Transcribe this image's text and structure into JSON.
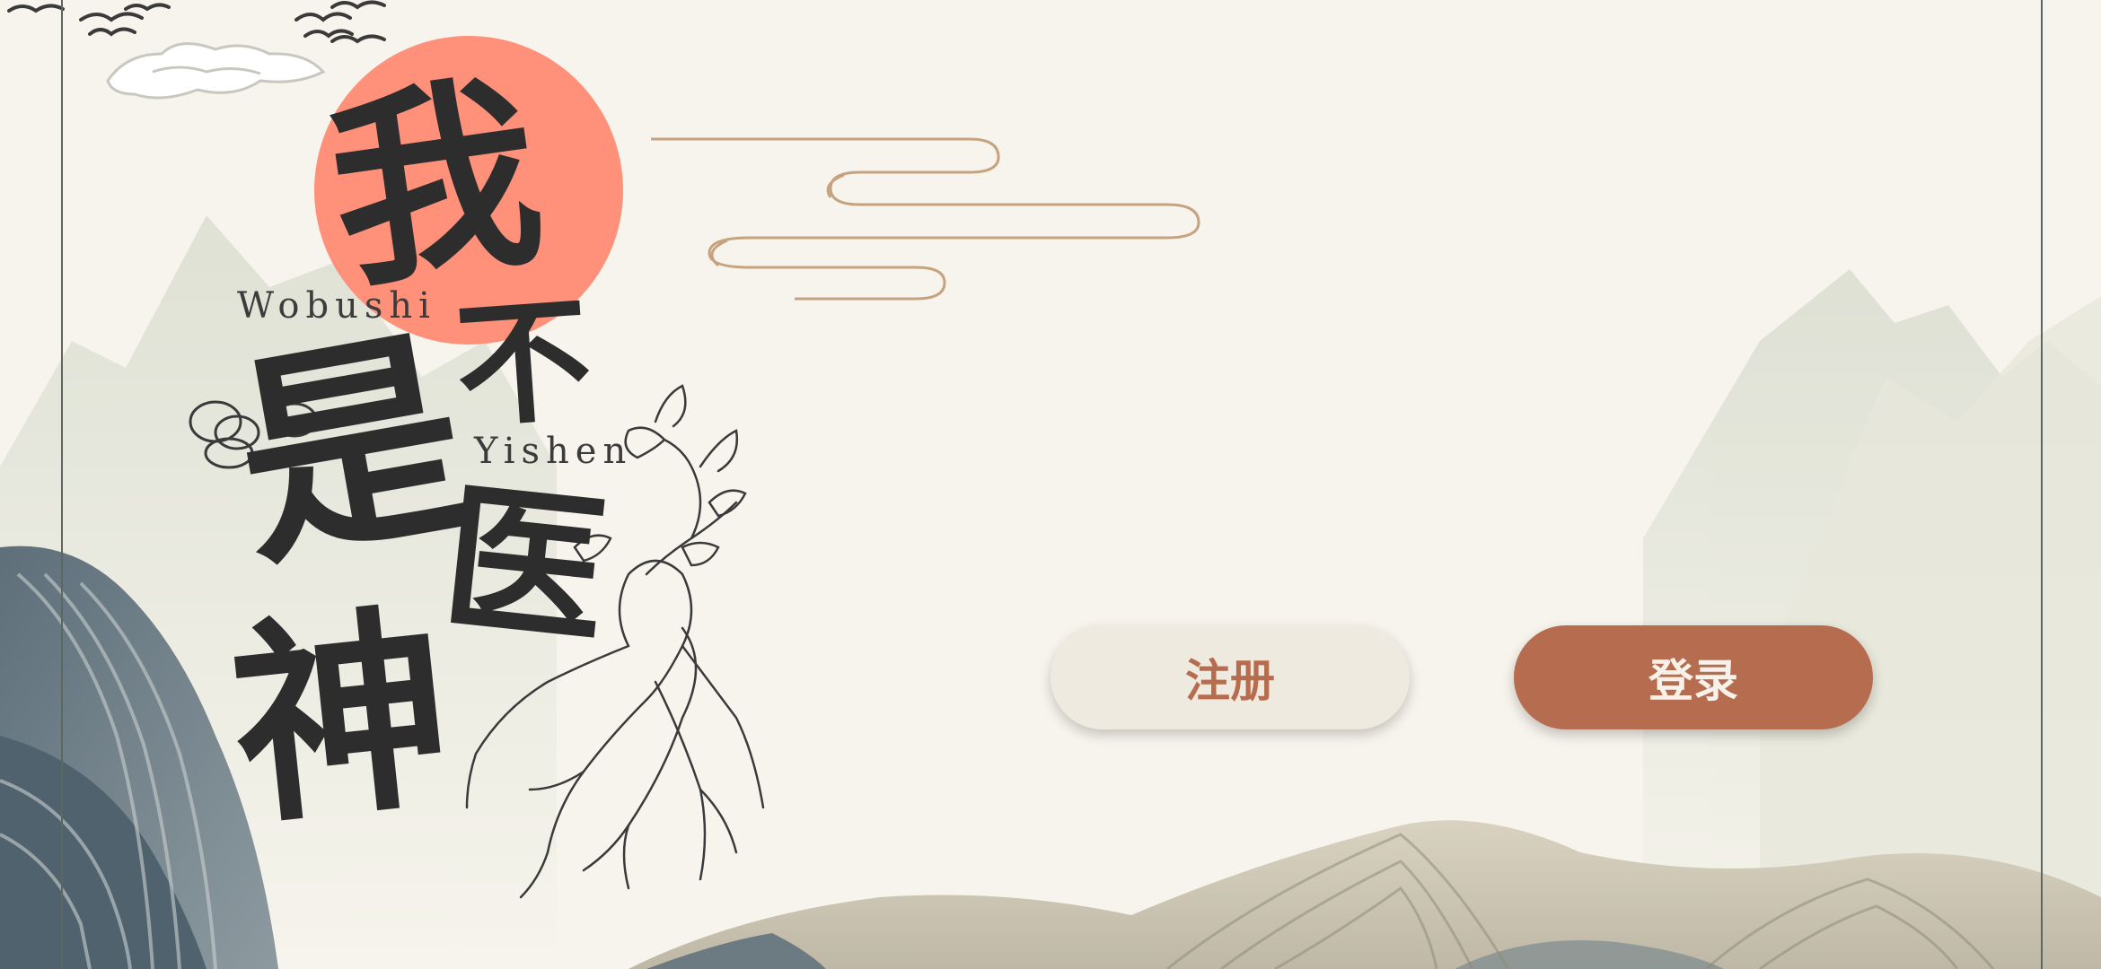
{
  "title": {
    "chars": [
      "我",
      "不",
      "是",
      "医",
      "神"
    ],
    "latin_top": "Wobushi",
    "latin_bottom": "Yishen",
    "seal_color": "#ff9079"
  },
  "actions": {
    "register_label": "注册",
    "login_label": "登录"
  },
  "colors": {
    "background": "#f6f4ec",
    "accent": "#b66d4f",
    "button_light": "#efeadf"
  }
}
